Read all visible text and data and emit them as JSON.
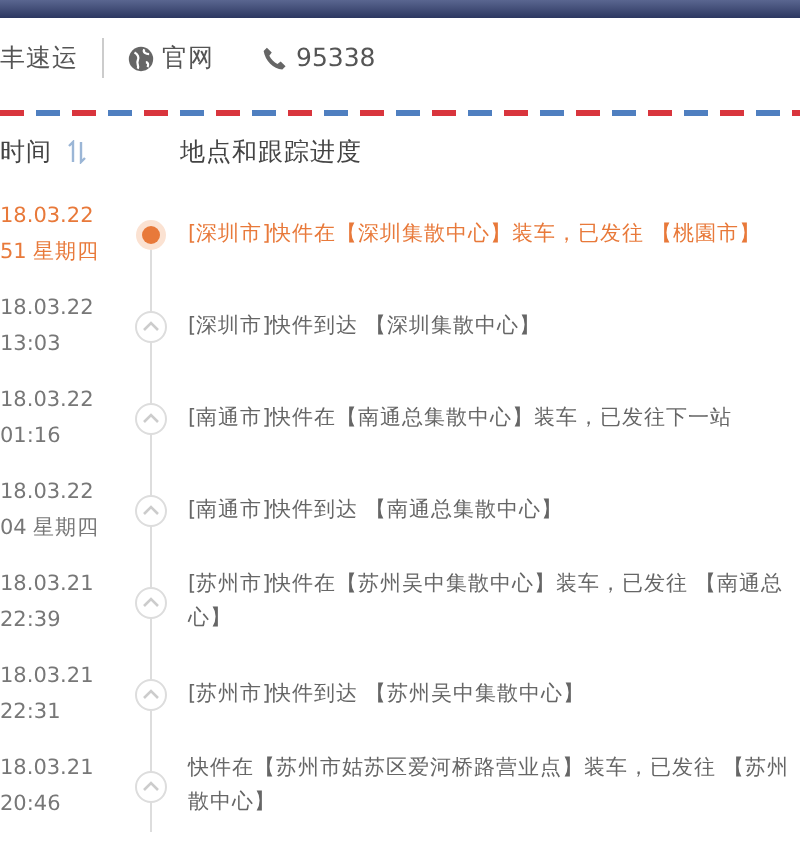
{
  "header": {
    "company": "丰速运",
    "website": "官网",
    "phone": "95338"
  },
  "columns": {
    "time": "时间",
    "progress": "地点和跟踪进度"
  },
  "events": [
    {
      "date": "18.03.22",
      "time": "51 星期四",
      "lines": [
        "[深圳市]快件在【深圳集散中心】装车，已发往 【桃園市】"
      ],
      "current": true
    },
    {
      "date": "18.03.22",
      "time": "13:03",
      "lines": [
        "[深圳市]快件到达 【深圳集散中心】"
      ],
      "current": false
    },
    {
      "date": "18.03.22",
      "time": "01:16",
      "lines": [
        "[南通市]快件在【南通总集散中心】装车，已发往下一站"
      ],
      "current": false
    },
    {
      "date": "18.03.22",
      "time": "04 星期四",
      "lines": [
        "[南通市]快件到达 【南通总集散中心】"
      ],
      "current": false
    },
    {
      "date": "18.03.21",
      "time": "22:39",
      "lines": [
        "[苏州市]快件在【苏州吴中集散中心】装车，已发往 【南通总",
        "心】"
      ],
      "current": false
    },
    {
      "date": "18.03.21",
      "time": "22:31",
      "lines": [
        "[苏州市]快件到达 【苏州吴中集散中心】"
      ],
      "current": false
    },
    {
      "date": "18.03.21",
      "time": "20:46",
      "lines": [
        "快件在【苏州市姑苏区爱河桥路营业点】装车，已发往 【苏州",
        "散中心】"
      ],
      "current": false
    }
  ]
}
